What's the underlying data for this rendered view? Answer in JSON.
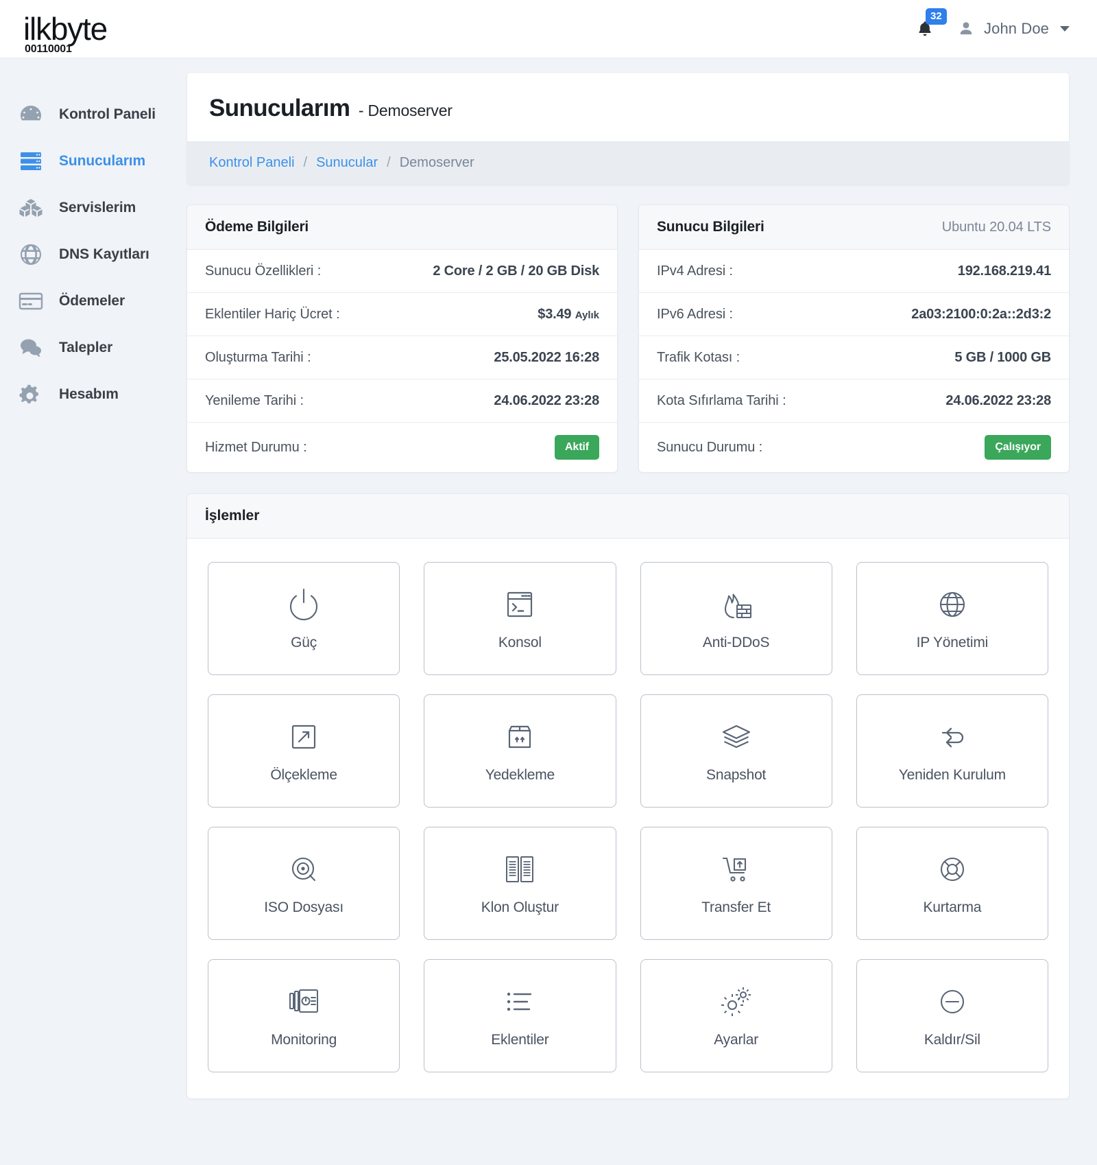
{
  "brand": {
    "name": "ilkbyte",
    "binary": "00110001"
  },
  "topbar": {
    "notification_count": "32",
    "notification_icon": "bell-icon",
    "user_icon": "user-avatar-icon",
    "user_name": "John Doe",
    "caret_icon": "chevron-down-icon",
    "accent_color": "#2f7fec"
  },
  "sidebar": {
    "items": [
      {
        "label": "Kontrol Paneli",
        "icon": "dashboard-gauge-icon",
        "active": false
      },
      {
        "label": "Sunucularım",
        "icon": "server-stack-icon",
        "active": true
      },
      {
        "label": "Servislerim",
        "icon": "boxes-icon",
        "active": false
      },
      {
        "label": "DNS Kayıtları",
        "icon": "globe-icon",
        "active": false
      },
      {
        "label": "Ödemeler",
        "icon": "credit-card-icon",
        "active": false
      },
      {
        "label": "Talepler",
        "icon": "chat-bubbles-icon",
        "active": false
      },
      {
        "label": "Hesabım",
        "icon": "gears-icon",
        "active": false
      }
    ],
    "active_color": "#3d90e8"
  },
  "header": {
    "title": "Sunucularım",
    "subtitle": "- Demoserver"
  },
  "breadcrumb": {
    "items": [
      {
        "label": "Kontrol Paneli",
        "link": true
      },
      {
        "label": "Sunucular",
        "link": true
      },
      {
        "label": "Demoserver",
        "link": false
      }
    ],
    "separator": "/"
  },
  "payment_card": {
    "title": "Ödeme Bilgileri",
    "rows": [
      {
        "label": "Sunucu Özellikleri :",
        "value": "2 Core / 2 GB / 20 GB Disk",
        "type": "text-small"
      },
      {
        "label": "Eklentiler Hariç Ücret :",
        "value": "$3.49",
        "unit": "Aylık",
        "type": "price"
      },
      {
        "label": "Oluşturma Tarihi :",
        "value": "25.05.2022 16:28",
        "type": "text"
      },
      {
        "label": "Yenileme Tarihi :",
        "value": "24.06.2022 23:28",
        "type": "text"
      },
      {
        "label": "Hizmet Durumu :",
        "value": "Aktif",
        "type": "badge",
        "badge_color": "#3aa75a"
      }
    ]
  },
  "server_card": {
    "title": "Sunucu Bilgileri",
    "os": "Ubuntu 20.04 LTS",
    "rows": [
      {
        "label": "IPv4 Adresi :",
        "value": "192.168.219.41",
        "type": "text"
      },
      {
        "label": "IPv6 Adresi :",
        "value": "2a03:2100:0:2a::2d3:2",
        "type": "text"
      },
      {
        "label": "Trafik Kotası :",
        "value": "5 GB / 1000 GB",
        "type": "text-small"
      },
      {
        "label": "Kota Sıfırlama Tarihi :",
        "value": "24.06.2022 23:28",
        "type": "text"
      },
      {
        "label": "Sunucu Durumu :",
        "value": "Çalışıyor",
        "type": "badge",
        "badge_color": "#3aa75a"
      }
    ]
  },
  "actions": {
    "title": "İşlemler",
    "tiles": [
      {
        "label": "Güç",
        "icon": "power-icon"
      },
      {
        "label": "Konsol",
        "icon": "terminal-window-icon"
      },
      {
        "label": "Anti-DDoS",
        "icon": "firewall-flame-icon"
      },
      {
        "label": "IP Yönetimi",
        "icon": "globe-icon"
      },
      {
        "label": "Ölçekleme",
        "icon": "scale-arrow-icon"
      },
      {
        "label": "Yedekleme",
        "icon": "box-upload-icon"
      },
      {
        "label": "Snapshot",
        "icon": "layers-icon"
      },
      {
        "label": "Yeniden Kurulum",
        "icon": "refresh-loop-icon"
      },
      {
        "label": "ISO Dosyası",
        "icon": "disc-icon"
      },
      {
        "label": "Klon Oluştur",
        "icon": "duplicate-docs-icon"
      },
      {
        "label": "Transfer Et",
        "icon": "cart-transfer-icon"
      },
      {
        "label": "Kurtarma",
        "icon": "lifebuoy-icon"
      },
      {
        "label": "Monitoring",
        "icon": "monitor-cards-icon"
      },
      {
        "label": "Eklentiler",
        "icon": "list-icon"
      },
      {
        "label": "Ayarlar",
        "icon": "gears-settings-icon"
      },
      {
        "label": "Kaldır/Sil",
        "icon": "minus-circle-icon"
      }
    ]
  }
}
